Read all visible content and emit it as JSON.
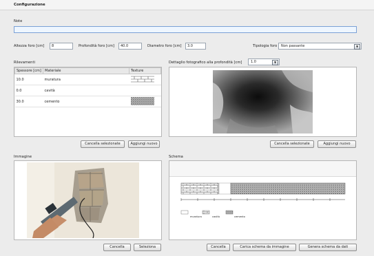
{
  "window": {
    "title": "Configurazione"
  },
  "note": {
    "label": "Note",
    "value": ""
  },
  "params": {
    "wall_height_label": "Altezza foro [cm]",
    "wall_height_value": "8",
    "hole_depth_label": "Profondità foro [cm]",
    "hole_depth_value": "40.0",
    "hole_diameter_label": "Diametro foro [cm]",
    "hole_diameter_value": "3.0",
    "hole_type_label": "Tipologia foro",
    "hole_type_value": "Non passante"
  },
  "layers": {
    "section_label": "Rilevamenti",
    "columns": [
      "Spessore [cm]",
      "Materiale",
      "Texture"
    ],
    "rows": [
      {
        "thickness": "10.0",
        "material": "muratura"
      },
      {
        "thickness": "0.0",
        "material": "cavità"
      },
      {
        "thickness": "30.0",
        "material": "cemento"
      }
    ],
    "delete_button": "Cancella selezionate",
    "add_button": "Aggiungi nuovo"
  },
  "photo_detail": {
    "label": "Dettaglio fotografico alla profondità [cm]",
    "depth_value": "1.0",
    "delete_button": "Cancella selezionate",
    "add_button": "Aggiungi nuovo"
  },
  "image_section": {
    "label": "Immagine",
    "delete_button": "Cancella",
    "select_button": "Seleziona"
  },
  "scheme_section": {
    "label": "Schema",
    "delete_button": "Cancella",
    "load_button": "Carica schema da immagine",
    "generate_button": "Genera schema da dati",
    "legend_labels": [
      "muratura",
      "cavità",
      "cemento"
    ]
  },
  "colors": {
    "accent": "#7aa0d6",
    "panel": "#f6f6f6",
    "background": "#ececec"
  }
}
